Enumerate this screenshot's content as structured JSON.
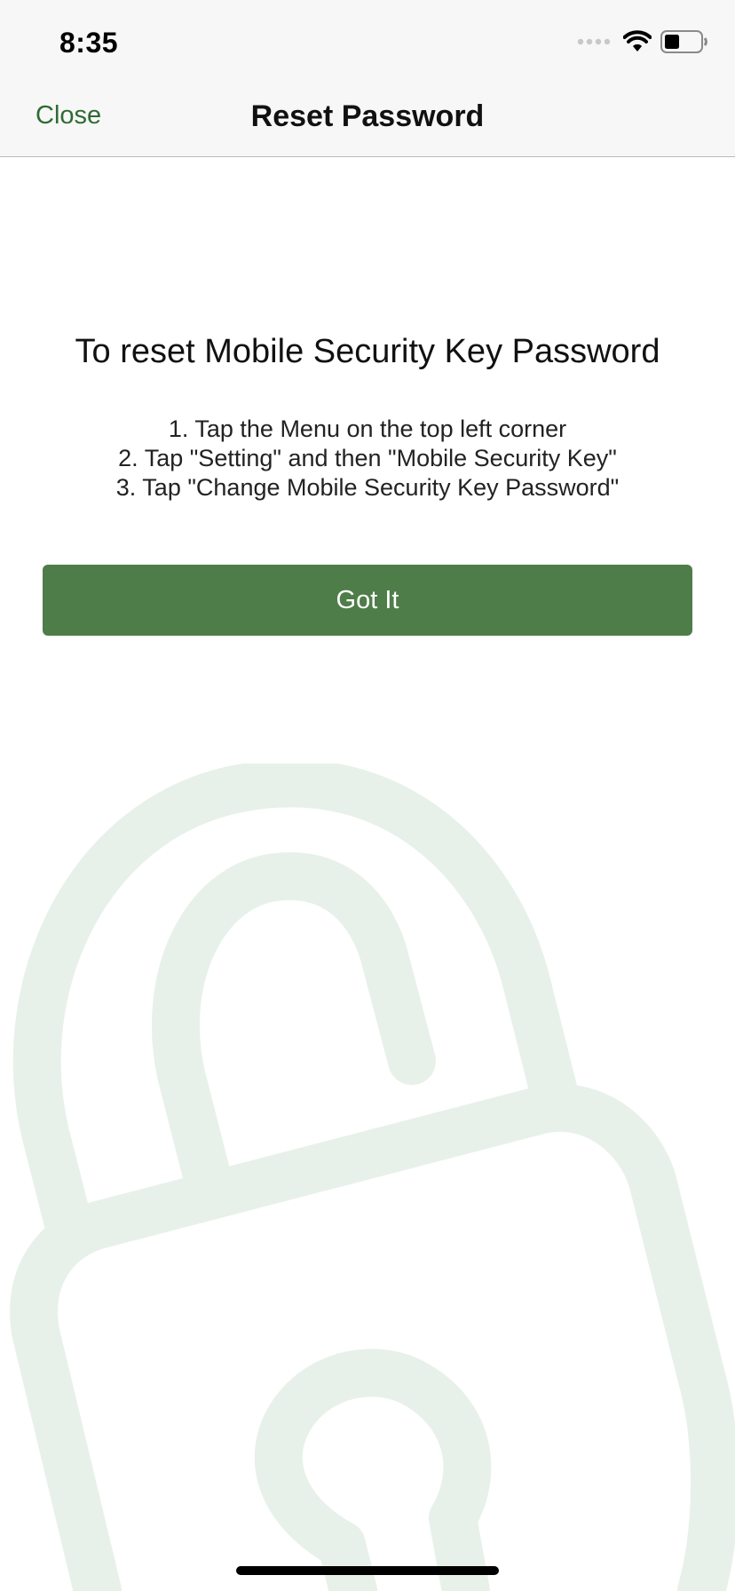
{
  "status_bar": {
    "time": "8:35",
    "icons": [
      "signal-dots-icon",
      "wifi-icon",
      "battery-icon"
    ]
  },
  "nav": {
    "close_label": "Close",
    "title": "Reset Password"
  },
  "main": {
    "heading": "To reset Mobile Security Key Password",
    "steps": [
      "1. Tap the Menu on the top left corner",
      "2. Tap \"Setting\" and then \"Mobile Security Key\"",
      "3. Tap \"Change Mobile Security Key Password\""
    ],
    "button_label": "Got It"
  },
  "colors": {
    "accent": "#2e6b33",
    "button": "#4f7d49",
    "lock_watermark": "#e8f1e9"
  },
  "background_icon": "padlock-icon"
}
